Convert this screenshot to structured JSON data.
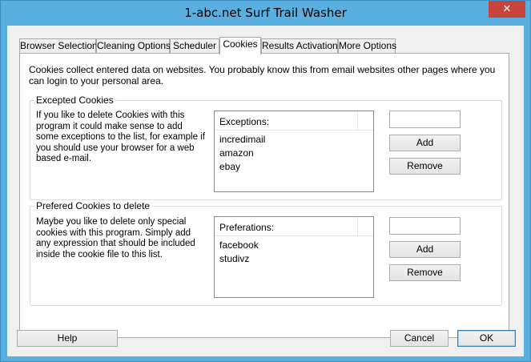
{
  "window": {
    "title": "1-abc.net Surf Trail Washer",
    "close_glyph": "✕"
  },
  "tabs": [
    {
      "label": "Browser Selection"
    },
    {
      "label": "Cleaning Options"
    },
    {
      "label": "Scheduler"
    },
    {
      "label": "Cookies",
      "active": true
    },
    {
      "label": "Results Activation"
    },
    {
      "label": "More Options"
    }
  ],
  "cookies": {
    "intro": "Cookies collect entered data on websites. You probably know this from email websites other pages where you can login to your personal area.",
    "excepted": {
      "title": "Excepted Cookies",
      "description": "If you like to delete Cookies with this program it could make sense to add some exceptions to the list, for example if you should use your browser for a web based e-mail.",
      "list_header": "Exceptions:",
      "items": [
        "incredimail",
        "amazon",
        "ebay"
      ],
      "input_value": "",
      "add_label": "Add",
      "remove_label": "Remove"
    },
    "preferred": {
      "title": "Prefered Cookies to delete",
      "description": "Maybe you like to delete only special cookies with this program. Simply add any expression that should be included inside the cookie file to this list.",
      "list_header": "Preferations:",
      "items": [
        "facebook",
        "studivz"
      ],
      "input_value": "",
      "add_label": "Add",
      "remove_label": "Remove"
    }
  },
  "footer": {
    "help_label": "Help",
    "cancel_label": "Cancel",
    "ok_label": "OK"
  },
  "colors": {
    "titlebar": "#59b0e0",
    "close_button": "#c7453a",
    "dialog_bg": "#f0f0f0",
    "panel_bg": "#ffffff"
  }
}
